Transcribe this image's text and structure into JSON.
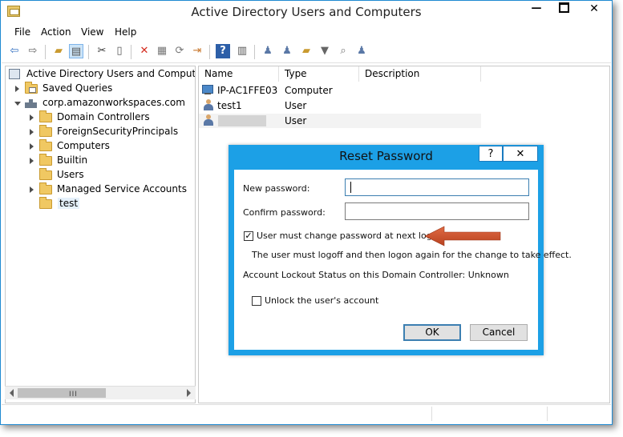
{
  "window": {
    "title": "Active Directory Users and Computers",
    "controls": {
      "minimize": "—",
      "close": "✕"
    }
  },
  "menu": [
    "File",
    "Action",
    "View",
    "Help"
  ],
  "toolbar": {
    "buttons": [
      "back-icon",
      "forward-icon",
      "up-folder-icon",
      "console-tree-icon",
      "cut-icon",
      "copy-icon",
      "delete-icon",
      "properties-icon",
      "refresh-icon",
      "export-icon",
      "help-icon",
      "action-pane-icon",
      "new-user-icon",
      "new-group-icon",
      "new-ou-icon",
      "filter-icon",
      "find-icon",
      "add-to-group-icon"
    ]
  },
  "tree": {
    "root": "Active Directory Users and Computers [",
    "saved_queries": "Saved Queries",
    "domain": "corp.amazonworkspaces.com",
    "children": [
      "Domain Controllers",
      "ForeignSecurityPrincipals",
      "Computers",
      "Builtin",
      "Users",
      "Managed Service Accounts",
      "test"
    ],
    "selected": "test"
  },
  "list": {
    "columns": [
      "Name",
      "Type",
      "Description"
    ],
    "rows": [
      {
        "name": "IP-AC1FFE03",
        "type": "Computer",
        "icon": "computer-icon"
      },
      {
        "name": "test1",
        "type": "User",
        "icon": "user-icon"
      },
      {
        "name": "",
        "type": "User",
        "icon": "user-icon"
      }
    ]
  },
  "dialog": {
    "title": "Reset Password",
    "help_label": "?",
    "close_label": "✕",
    "new_password_label": "New password:",
    "new_password_value": "",
    "confirm_password_label": "Confirm password:",
    "confirm_password_value": "",
    "must_change_label": "User must change password at next logon",
    "must_change_checked": true,
    "info_text": "The user must logoff and then logon again for the change to take effect.",
    "lockout_status": "Account Lockout Status on this Domain Controller: Unknown",
    "unlock_label": "Unlock the user's account",
    "unlock_checked": false,
    "ok_label": "OK",
    "cancel_label": "Cancel"
  },
  "colors": {
    "dialog_frame": "#1ca0e6",
    "annotation_arrow": "#d0532f"
  }
}
